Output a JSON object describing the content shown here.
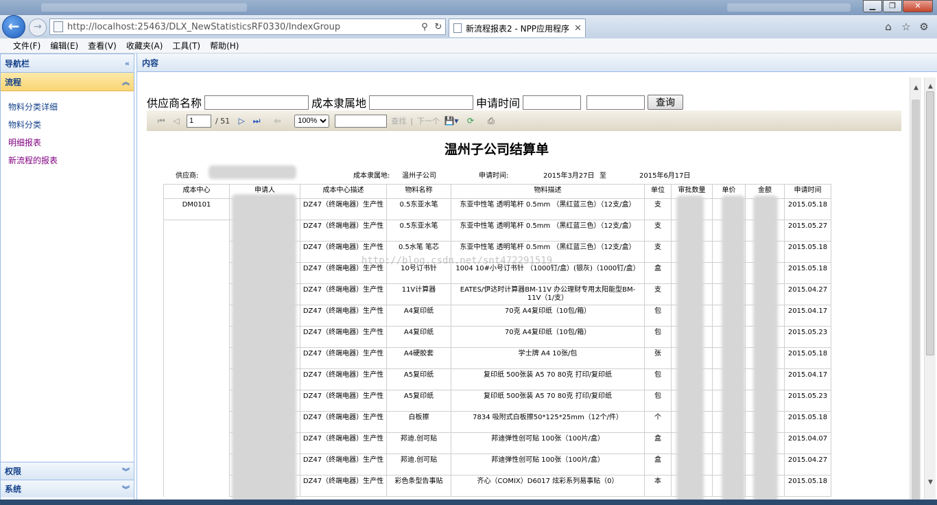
{
  "browser": {
    "url": "http://localhost:25463/DLX_NewStatisticsRF0330/IndexGroup",
    "tab_title": "新流程报表2 - NPP应用程序",
    "menu": [
      "文件(F)",
      "编辑(E)",
      "查看(V)",
      "收藏夹(A)",
      "工具(T)",
      "帮助(H)"
    ]
  },
  "sidebar": {
    "title": "导航栏",
    "section": "流程",
    "links": [
      {
        "label": "物料分类详细",
        "visited": false
      },
      {
        "label": "物料分类",
        "visited": false
      },
      {
        "label": "明细报表",
        "visited": true
      },
      {
        "label": "新流程的报表",
        "visited": true
      }
    ],
    "bottom_sections": [
      "权限",
      "系统"
    ]
  },
  "content": {
    "title": "内容"
  },
  "filter": {
    "supplier_label": "供应商名称",
    "cost_owner_label": "成本隶属地",
    "apply_time_label": "申请时间",
    "query_button": "查询"
  },
  "toolbar": {
    "page": "1",
    "total_pages": "/ 51",
    "zoom": "100%",
    "find": "查找",
    "next": "下一个"
  },
  "report": {
    "title": "温州子公司结算单",
    "supplier_label": "供应商:",
    "cost_owner_label": "成本隶属地:",
    "cost_owner_value": "温州子公司",
    "apply_time_label": "申请时间:",
    "date_from": "2015年3月27日",
    "date_to_sep": "至",
    "date_to": "2015年6月17日",
    "columns": [
      "成本中心",
      "申请人",
      "成本中心描述",
      "物料名称",
      "物料描述",
      "单位",
      "审批数量",
      "单价",
      "金额",
      "申请时间"
    ],
    "cost_center": "DM0101",
    "rows": [
      {
        "desc": "DZ47（终端电器）生产性",
        "name": "0.5东亚水笔",
        "mdesc": "东亚中性笔 透明笔杆 0.5mm （黑红蓝三色）（12支/盒）",
        "unit": "支",
        "date": "2015.05.18"
      },
      {
        "desc": "DZ47（终端电器）生产性",
        "name": "0.5东亚水笔",
        "mdesc": "东亚中性笔 透明笔杆 0.5mm （黑红蓝三色）（12支/盒）",
        "unit": "支",
        "date": "2015.05.27"
      },
      {
        "desc": "DZ47（终端电器）生产性",
        "name": "0.5水笔 笔芯",
        "mdesc": "东亚中性笔 透明笔杆 0.5mm （黑红蓝三色）（12支/盒）",
        "unit": "支",
        "date": "2015.05.18"
      },
      {
        "desc": "DZ47（终端电器）生产性",
        "name": "10号订书针",
        "mdesc": "1004 10#小号订书针 （1000钉/盒）(银灰)（1000钉/盒）",
        "unit": "盒",
        "date": "2015.05.18"
      },
      {
        "desc": "DZ47（终端电器）生产性",
        "name": "11V计算器",
        "mdesc": "EATES/伊达时计算器BM-11V 办公理财专用太阳能型BM-11V（1/支）",
        "unit": "支",
        "date": "2015.04.27"
      },
      {
        "desc": "DZ47（终端电器）生产性",
        "name": "A4复印纸",
        "mdesc": "70克 A4复印纸（10包/箱）",
        "unit": "包",
        "date": "2015.04.17"
      },
      {
        "desc": "DZ47（终端电器）生产性",
        "name": "A4复印纸",
        "mdesc": "70克 A4复印纸（10包/箱）",
        "unit": "包",
        "date": "2015.05.23"
      },
      {
        "desc": "DZ47（终端电器）生产性",
        "name": "A4硬胶套",
        "mdesc": "学士牌 A4 10张/包",
        "unit": "张",
        "date": "2015.05.18"
      },
      {
        "desc": "DZ47（终端电器）生产性",
        "name": "A5复印纸",
        "mdesc": "复印纸 500张装 A5 70 80克 打印/复印纸",
        "unit": "包",
        "date": "2015.04.17"
      },
      {
        "desc": "DZ47（终端电器）生产性",
        "name": "A5复印纸",
        "mdesc": "复印纸 500张装 A5 70 80克 打印/复印纸",
        "unit": "包",
        "date": "2015.05.23"
      },
      {
        "desc": "DZ47（终端电器）生产性",
        "name": "白板擦",
        "mdesc": "7834 吸附式白板擦50*125*25mm（12个/件）",
        "unit": "个",
        "date": "2015.05.18"
      },
      {
        "desc": "DZ47（终端电器）生产性",
        "name": "邦迪.创可贴",
        "mdesc": "邦迪弹性创可贴 100张（100片/盒）",
        "unit": "盒",
        "date": "2015.04.07"
      },
      {
        "desc": "DZ47（终端电器）生产性",
        "name": "邦迪.创可贴",
        "mdesc": "邦迪弹性创可贴 100张（100片/盒）",
        "unit": "盒",
        "date": "2015.04.27"
      },
      {
        "desc": "DZ47（终端电器）生产性",
        "name": "彩色条型告事贴",
        "mdesc": "齐心（COMIX）D6017 炫彩系列易事贴（0）",
        "unit": "本",
        "date": "2015.05.18"
      }
    ],
    "watermark": "http://blog.csdn.net/snt472291519"
  }
}
